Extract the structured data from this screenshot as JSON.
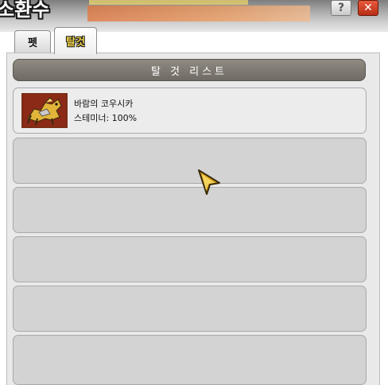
{
  "window": {
    "title": "소환수"
  },
  "tabs": [
    {
      "label": "펫",
      "selected": false
    },
    {
      "label": "탈것",
      "selected": true
    }
  ],
  "list": {
    "header": "탈 것 리스트",
    "items": [
      {
        "name": "바람의 코우시카",
        "stamina": "스테미너: 100%"
      }
    ],
    "empty_slots": 5
  },
  "icons": {
    "help": "?",
    "close": "✕"
  },
  "colors": {
    "selected_tab_text": "#f3d64a",
    "header_bg": "#7f7a72",
    "slot_bg": "#d3d3d3",
    "close_button": "#c83a22"
  }
}
